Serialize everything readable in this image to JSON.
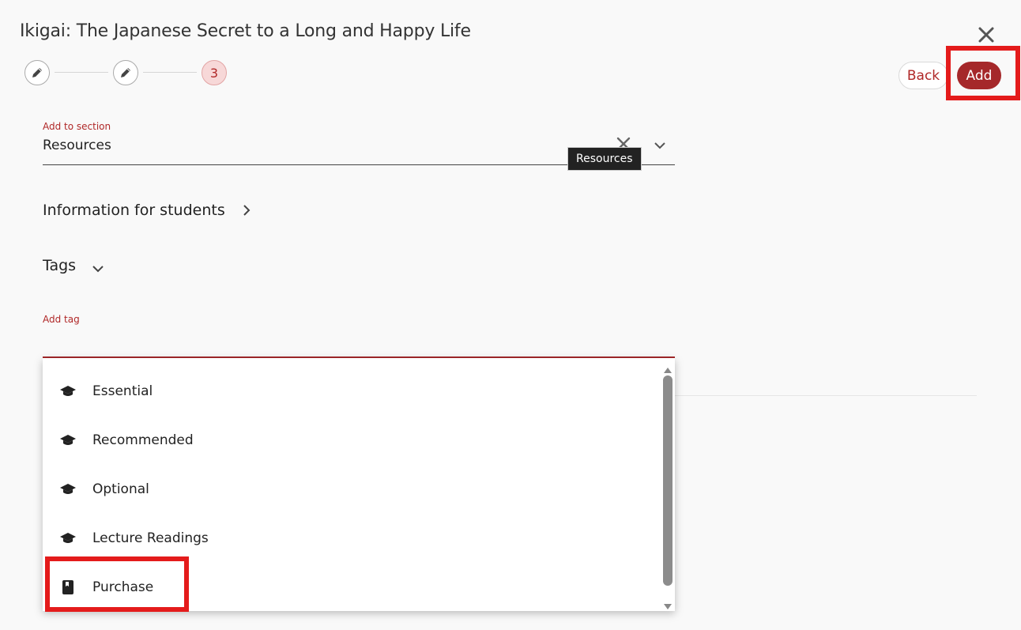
{
  "dialog": {
    "title": "Ikigai: The Japanese Secret to a Long and Happy Life"
  },
  "stepper": {
    "steps": [
      {
        "type": "edit"
      },
      {
        "type": "edit"
      },
      {
        "label": "3"
      }
    ]
  },
  "actions": {
    "back_label": "Back",
    "add_label": "Add"
  },
  "section_field": {
    "label": "Add to section",
    "value": "Resources",
    "tooltip": "Resources"
  },
  "info": {
    "label": "Information for students"
  },
  "tags": {
    "label": "Tags",
    "add_tag_label": "Add tag"
  },
  "dropdown": {
    "items": [
      {
        "label": "Essential",
        "icon": "graduation-cap-icon"
      },
      {
        "label": "Recommended",
        "icon": "graduation-cap-icon"
      },
      {
        "label": "Optional",
        "icon": "graduation-cap-icon"
      },
      {
        "label": "Lecture Readings",
        "icon": "graduation-cap-icon"
      },
      {
        "label": "Purchase",
        "icon": "book-icon"
      }
    ]
  },
  "colors": {
    "accent": "#a5282a",
    "highlight": "#e41b1b",
    "step_active_bg": "#f7d8d8"
  }
}
